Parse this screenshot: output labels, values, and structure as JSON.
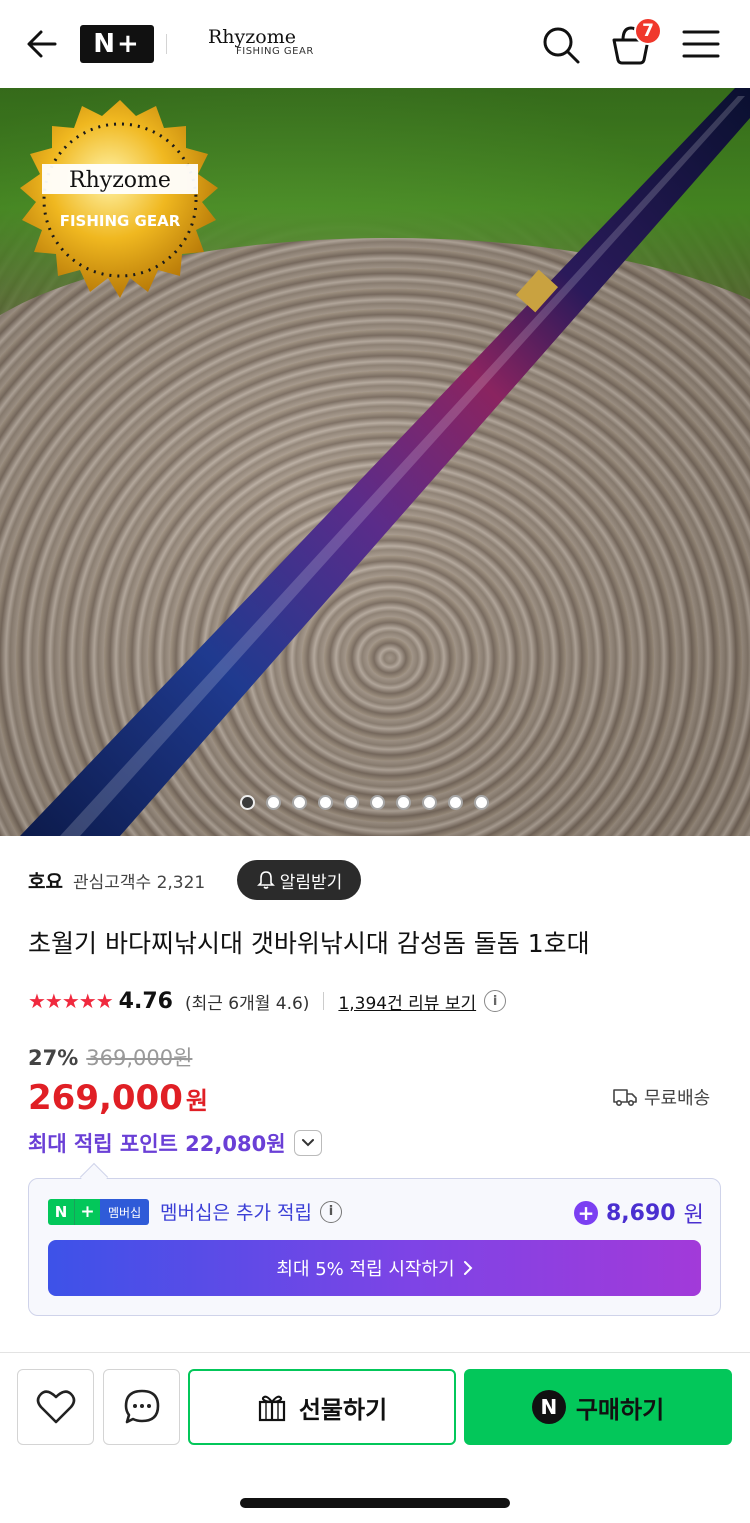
{
  "header": {
    "nplus_logo": "N+",
    "brand_logo_main": "Rhyzome",
    "brand_logo_sub": "FISHING GEAR",
    "cart_count": "7"
  },
  "hero": {
    "seal_text_main": "Rhyzome",
    "seal_text_sub": "FISHING GEAR",
    "slide_count": 10,
    "active_slide": 1
  },
  "store": {
    "name": "호요",
    "followers_label": "관심고객수 2,321",
    "alarm_button": "알림받기"
  },
  "product": {
    "title": "초월기 바다찌낚시대 갯바위낚시대 감성돔 돌돔 1호대",
    "stars": "★★★★★",
    "rating": "4.76",
    "recent_rating": "(최근 6개월 4.6)",
    "review_link": "1,394건 리뷰 보기",
    "discount": "27%",
    "original_price": "369,000원",
    "sale_price": "269,000",
    "currency": "원",
    "shipping": "무료배송",
    "max_points": "최대 적립 포인트 22,080원"
  },
  "membership": {
    "badge_n": "N",
    "badge_plus": "+",
    "badge_label": "멤버십",
    "text": "멤버십은 추가 적립",
    "points": "8,690",
    "points_unit": "원",
    "cta": "최대 5% 적립 시작하기"
  },
  "bottom_bar": {
    "gift": "선물하기",
    "buy_n": "N",
    "buy": "구매하기"
  },
  "colors": {
    "accent_red": "#e01f25",
    "naver_green": "#03c75a",
    "points_purple": "#6a3fd6",
    "star_red": "#f0293e"
  }
}
